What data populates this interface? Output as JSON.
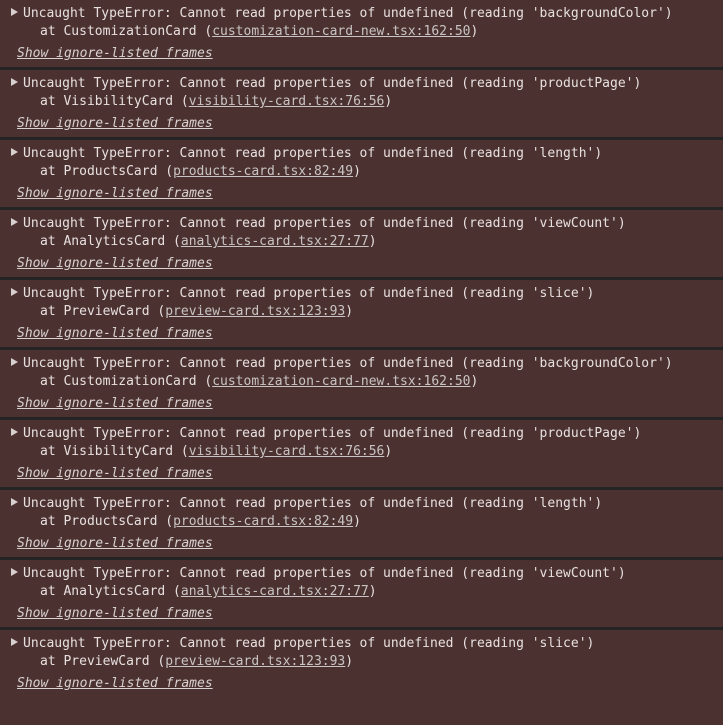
{
  "console": {
    "entries": [
      {
        "message": "Uncaught TypeError: Cannot read properties of undefined (reading 'backgroundColor')",
        "at_prefix": "at CustomizationCard (",
        "source": "customization-card-new.tsx:162:50",
        "suffix": ")",
        "show_ignore": "Show ignore-listed frames"
      },
      {
        "message": "Uncaught TypeError: Cannot read properties of undefined (reading 'productPage')",
        "at_prefix": "at VisibilityCard (",
        "source": "visibility-card.tsx:76:56",
        "suffix": ")",
        "show_ignore": "Show ignore-listed frames"
      },
      {
        "message": "Uncaught TypeError: Cannot read properties of undefined (reading 'length')",
        "at_prefix": "at ProductsCard (",
        "source": "products-card.tsx:82:49",
        "suffix": ")",
        "show_ignore": "Show ignore-listed frames"
      },
      {
        "message": "Uncaught TypeError: Cannot read properties of undefined (reading 'viewCount')",
        "at_prefix": "at AnalyticsCard (",
        "source": "analytics-card.tsx:27:77",
        "suffix": ")",
        "show_ignore": "Show ignore-listed frames"
      },
      {
        "message": "Uncaught TypeError: Cannot read properties of undefined (reading 'slice')",
        "at_prefix": "at PreviewCard (",
        "source": "preview-card.tsx:123:93",
        "suffix": ")",
        "show_ignore": "Show ignore-listed frames"
      },
      {
        "message": "Uncaught TypeError: Cannot read properties of undefined (reading 'backgroundColor')",
        "at_prefix": "at CustomizationCard (",
        "source": "customization-card-new.tsx:162:50",
        "suffix": ")",
        "show_ignore": "Show ignore-listed frames"
      },
      {
        "message": "Uncaught TypeError: Cannot read properties of undefined (reading 'productPage')",
        "at_prefix": "at VisibilityCard (",
        "source": "visibility-card.tsx:76:56",
        "suffix": ")",
        "show_ignore": "Show ignore-listed frames"
      },
      {
        "message": "Uncaught TypeError: Cannot read properties of undefined (reading 'length')",
        "at_prefix": "at ProductsCard (",
        "source": "products-card.tsx:82:49",
        "suffix": ")",
        "show_ignore": "Show ignore-listed frames"
      },
      {
        "message": "Uncaught TypeError: Cannot read properties of undefined (reading 'viewCount')",
        "at_prefix": "at AnalyticsCard (",
        "source": "analytics-card.tsx:27:77",
        "suffix": ")",
        "show_ignore": "Show ignore-listed frames"
      },
      {
        "message": "Uncaught TypeError: Cannot read properties of undefined (reading 'slice')",
        "at_prefix": "at PreviewCard (",
        "source": "preview-card.tsx:123:93",
        "suffix": ")",
        "show_ignore": "Show ignore-listed frames"
      }
    ]
  },
  "icons": {
    "expand": "expand-arrow-icon"
  },
  "colors": {
    "error_background": "#4b3231",
    "separator": "#242424",
    "text": "#e8e0df"
  }
}
